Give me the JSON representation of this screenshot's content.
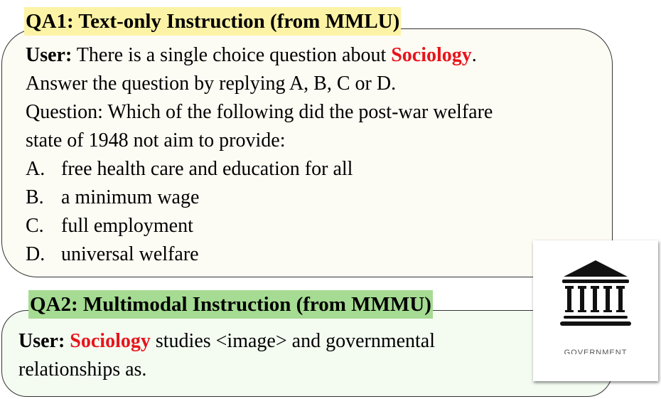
{
  "qa1": {
    "title": "QA1: Text-only Instruction (from MMLU)",
    "user_label": "User:",
    "intro_pre": "There is a single choice question about ",
    "subject": "Sociology",
    "intro_post": ".",
    "line2": "Answer the question by replying A, B, C or D.",
    "line3": "Question: Which of the following did the post-war welfare",
    "line4": "state of 1948 not aim to provide:",
    "options": [
      {
        "letter": "A.",
        "text": "free health care and education for all"
      },
      {
        "letter": "B.",
        "text": "a minimum wage"
      },
      {
        "letter": "C.",
        "text": "full employment"
      },
      {
        "letter": "D.",
        "text": "universal welfare"
      }
    ]
  },
  "qa2": {
    "title": "QA2: Multimodal Instruction (from MMMU)",
    "user_label": "User:",
    "subject": "Sociology",
    "rest": " studies <image> and governmental",
    "line2": "relationships as."
  },
  "image": {
    "icon": "government-building-icon",
    "caption": "GOVERNMENT"
  },
  "colors": {
    "qa1_highlight": "#fdf3a6",
    "qa2_highlight": "#a5db92",
    "subject": "#e8141b"
  }
}
